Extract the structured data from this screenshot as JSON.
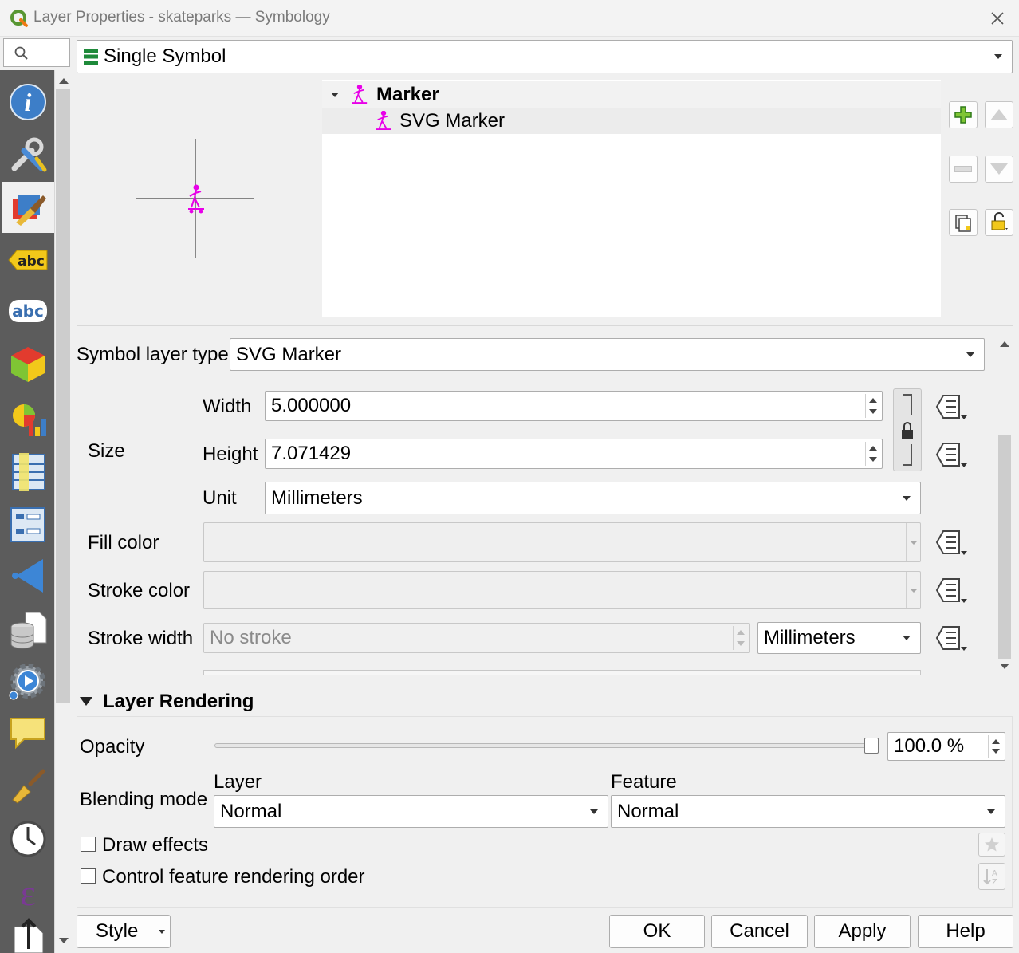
{
  "window": {
    "title": "Layer Properties - skateparks — Symbology"
  },
  "renderer": {
    "selected": "Single Symbol"
  },
  "symbol_tree": {
    "root_label": "Marker",
    "child_label": "SVG Marker"
  },
  "symbol_layer": {
    "type_label": "Symbol layer type",
    "type_value": "SVG Marker",
    "size_label": "Size",
    "width_label": "Width",
    "width_value": "5.000000",
    "height_label": "Height",
    "height_value": "7.071429",
    "unit_label": "Unit",
    "unit_value": "Millimeters",
    "fill_color_label": "Fill color",
    "stroke_color_label": "Stroke color",
    "stroke_width_label": "Stroke width",
    "stroke_width_placeholder": "No stroke",
    "stroke_unit_value": "Millimeters"
  },
  "layer_rendering": {
    "title": "Layer Rendering",
    "opacity_label": "Opacity",
    "opacity_value": "100.0 %",
    "opacity_fraction": 1.0,
    "blending_label": "Blending mode",
    "layer_label": "Layer",
    "layer_value": "Normal",
    "feature_label": "Feature",
    "feature_value": "Normal",
    "draw_effects_label": "Draw effects",
    "draw_effects_checked": false,
    "order_label": "Control feature rendering order",
    "order_checked": false
  },
  "footer": {
    "style_label": "Style",
    "ok_label": "OK",
    "cancel_label": "Cancel",
    "apply_label": "Apply",
    "help_label": "Help"
  },
  "sidebar": {
    "items": [
      {
        "name": "information-icon"
      },
      {
        "name": "source-icon"
      },
      {
        "name": "symbology-icon",
        "active": true
      },
      {
        "name": "labels-icon"
      },
      {
        "name": "masks-icon"
      },
      {
        "name": "3d-view-icon"
      },
      {
        "name": "diagrams-icon"
      },
      {
        "name": "fields-icon"
      },
      {
        "name": "attributes-form-icon"
      },
      {
        "name": "joins-icon"
      },
      {
        "name": "auxiliary-storage-icon"
      },
      {
        "name": "actions-icon"
      },
      {
        "name": "display-icon"
      },
      {
        "name": "rendering-icon"
      },
      {
        "name": "temporal-icon"
      },
      {
        "name": "variables-icon"
      },
      {
        "name": "metadata-icon"
      }
    ]
  },
  "colors": {
    "accent": "#1e7a1e",
    "symbol_magenta": "#e800e8",
    "sidebar_bg": "#5c5c5c"
  }
}
